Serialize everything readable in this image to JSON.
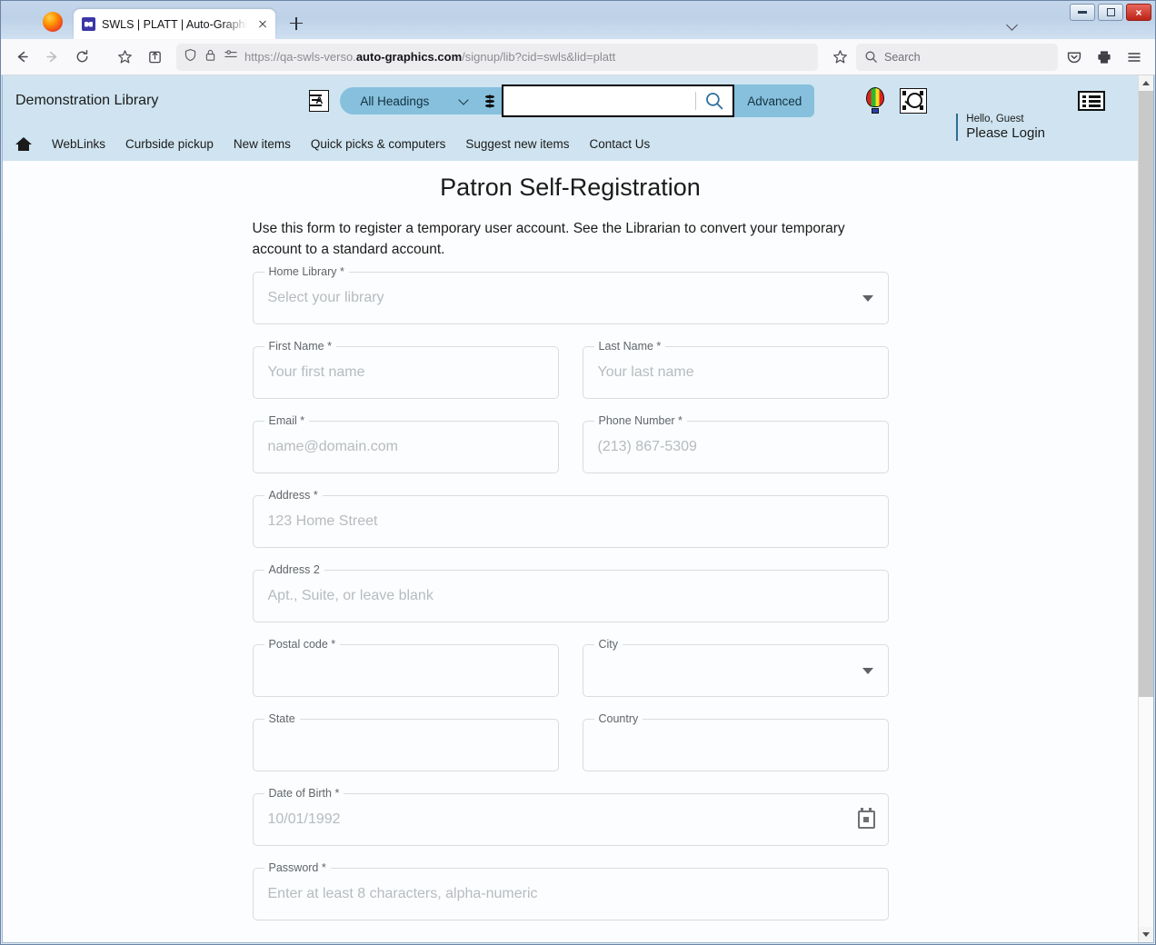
{
  "browser": {
    "tab": {
      "title": "SWLS | PLATT | Auto-Graphics In",
      "favicon": "site-favicon"
    },
    "newtab_label": "+",
    "url": {
      "prefix": "https://qa-swls-verso.",
      "domain": "auto-graphics.com",
      "path": "/signup/lib?cid=swls&lid=platt"
    },
    "search_placeholder": "Search",
    "icons": {
      "back": "back-arrow-icon",
      "forward": "forward-arrow-icon",
      "reload": "reload-icon",
      "bookmark": "star-icon",
      "save_to_pocket_toolbar": "pocket-icon",
      "container": "container-tab-icon",
      "shield": "shield-icon",
      "lock": "lock-icon",
      "permissions": "permissions-icon",
      "star": "star-icon",
      "print": "printer-icon",
      "menu": "hamburger-menu-icon"
    },
    "window_controls": {
      "minimize": "minimize-button",
      "maximize": "maximize-button",
      "close": "×"
    }
  },
  "site": {
    "library_name": "Demonstration Library",
    "search": {
      "scope_label": "All Headings",
      "query": "",
      "advanced_label": "Advanced",
      "translate_icon": "translate-icon",
      "database_icon": "database-stack-icon",
      "magnifier_icon": "search-icon"
    },
    "header_icons": {
      "balloon": "hot-air-balloon-icon",
      "film": "filmstrip-search-icon",
      "list": "list-view-icon"
    },
    "nav": [
      {
        "label": "WebLinks"
      },
      {
        "label": "Curbside pickup"
      },
      {
        "label": "New items"
      },
      {
        "label": "Quick picks & computers"
      },
      {
        "label": "Suggest new items"
      },
      {
        "label": "Contact Us"
      }
    ],
    "account": {
      "greeting": "Hello, Guest",
      "login_label": "Please Login"
    }
  },
  "page": {
    "title": "Patron Self-Registration",
    "intro": "Use this form to register a temporary user account. See the Librarian to convert your temporary account to a standard account.",
    "fields": {
      "home_library": {
        "label": "Home Library *",
        "value": "Select your library",
        "type": "select"
      },
      "first_name": {
        "label": "First Name *",
        "value": "Your first name",
        "type": "text"
      },
      "last_name": {
        "label": "Last Name *",
        "value": "Your last name",
        "type": "text"
      },
      "email": {
        "label": "Email *",
        "value": "name@domain.com",
        "type": "email"
      },
      "phone": {
        "label": "Phone Number *",
        "value": "(213) 867-5309",
        "type": "tel"
      },
      "address": {
        "label": "Address *",
        "value": "123 Home Street",
        "type": "text"
      },
      "address2": {
        "label": "Address 2",
        "value": "Apt., Suite, or leave blank",
        "type": "text"
      },
      "postal_code": {
        "label": "Postal code *",
        "value": "",
        "type": "text"
      },
      "city": {
        "label": "City",
        "value": "",
        "type": "select"
      },
      "state": {
        "label": "State",
        "value": "",
        "type": "text"
      },
      "country": {
        "label": "Country",
        "value": "",
        "type": "text"
      },
      "date_of_birth": {
        "label": "Date of Birth *",
        "value": "10/01/1992",
        "type": "date"
      },
      "password": {
        "label": "Password *",
        "value": "Enter at least 8 characters, alpha-numeric",
        "type": "password"
      }
    }
  }
}
